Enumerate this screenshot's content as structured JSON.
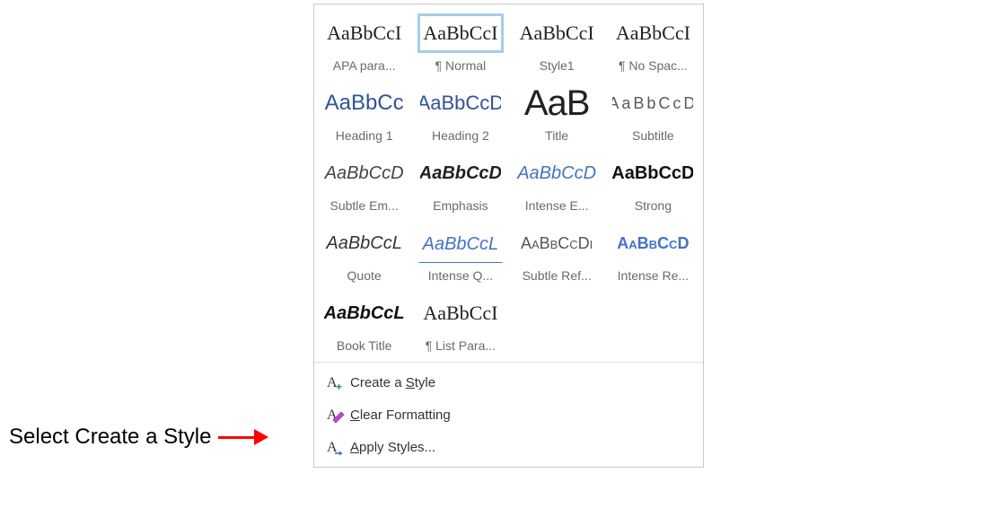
{
  "callout": {
    "text": "Select Create a Style"
  },
  "preview_sample": "AaBbCcI",
  "styles": [
    {
      "label": "APA para...",
      "previewClass": "",
      "sample": "AaBbCcI",
      "selected": false
    },
    {
      "label": "¶ Normal",
      "previewClass": "",
      "sample": "AaBbCcI",
      "selected": true
    },
    {
      "label": "Style1",
      "previewClass": "",
      "sample": "AaBbCcI",
      "selected": false
    },
    {
      "label": "¶ No Spac...",
      "previewClass": "",
      "sample": "AaBbCcI",
      "selected": false
    },
    {
      "label": "Heading 1",
      "previewClass": "p-heading1",
      "sample": "AaBbCc",
      "selected": false
    },
    {
      "label": "Heading 2",
      "previewClass": "p-heading2",
      "sample": "AaBbCcD",
      "selected": false
    },
    {
      "label": "Title",
      "previewClass": "p-title",
      "sample": "AaB",
      "selected": false
    },
    {
      "label": "Subtitle",
      "previewClass": "p-subtitle",
      "sample": "AaBbCcD",
      "selected": false
    },
    {
      "label": "Subtle Em...",
      "previewClass": "p-subtleem",
      "sample": "AaBbCcD",
      "selected": false
    },
    {
      "label": "Emphasis",
      "previewClass": "p-emphasis",
      "sample": "AaBbCcD",
      "selected": false
    },
    {
      "label": "Intense E...",
      "previewClass": "p-intense",
      "sample": "AaBbCcD",
      "selected": false
    },
    {
      "label": "Strong",
      "previewClass": "p-strong",
      "sample": "AaBbCcD",
      "selected": false
    },
    {
      "label": "Quote",
      "previewClass": "p-quote",
      "sample": "AaBbCcL",
      "selected": false
    },
    {
      "label": "Intense Q...",
      "previewClass": "p-intenseq",
      "sample": "AaBbCcL",
      "selected": false
    },
    {
      "label": "Subtle Ref...",
      "previewClass": "p-subtleref",
      "sample": "AaBbCcDi",
      "selected": false
    },
    {
      "label": "Intense Re...",
      "previewClass": "p-intenseref",
      "sample": "AaBbCcD",
      "selected": false
    },
    {
      "label": "Book Title",
      "previewClass": "p-booktitle",
      "sample": "AaBbCcL",
      "selected": false
    },
    {
      "label": "¶ List Para...",
      "previewClass": "p-listpara",
      "sample": "AaBbCcI",
      "selected": false
    }
  ],
  "menu": {
    "create": {
      "pre": "Create a ",
      "ul": "S",
      "post": "tyle"
    },
    "clear": {
      "pre": "",
      "ul": "C",
      "post": "lear Formatting"
    },
    "apply": {
      "pre": "",
      "ul": "A",
      "post": "pply Styles..."
    }
  }
}
